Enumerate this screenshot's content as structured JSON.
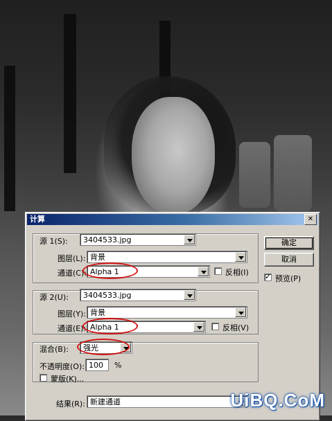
{
  "dialog": {
    "title": "计算",
    "close_icon": "close-icon"
  },
  "source1": {
    "label": "源 1(S):",
    "file": "3404533.jpg",
    "layer_label": "图层(L):",
    "layer_value": "背景",
    "channel_label": "通道(C):",
    "channel_value": "Alpha 1",
    "invert_label": "反相(I)",
    "invert_checked": false
  },
  "source2": {
    "label": "源 2(U):",
    "file": "3404533.jpg",
    "layer_label": "图层(Y):",
    "layer_value": "背景",
    "channel_label": "通道(E):",
    "channel_value": "Alpha 1",
    "invert_label": "反相(V)",
    "invert_checked": false
  },
  "blend": {
    "label": "混合(B):",
    "mode": "强光",
    "opacity_label": "不透明度(O):",
    "opacity_value": "100",
    "percent": "%",
    "mask_label": "蒙版(K)...",
    "mask_checked": false
  },
  "result": {
    "label": "结果(R):",
    "value": "新建通道"
  },
  "buttons": {
    "ok": "确定",
    "cancel": "取消"
  },
  "preview": {
    "label": "预览(P)",
    "checked": true
  },
  "watermark": "UiBQ.CoM",
  "colors": {
    "dialog_bg": "#d4d0c8",
    "title_start": "#0a246a",
    "title_end": "#a6caf0",
    "highlight_red": "#d10000"
  }
}
